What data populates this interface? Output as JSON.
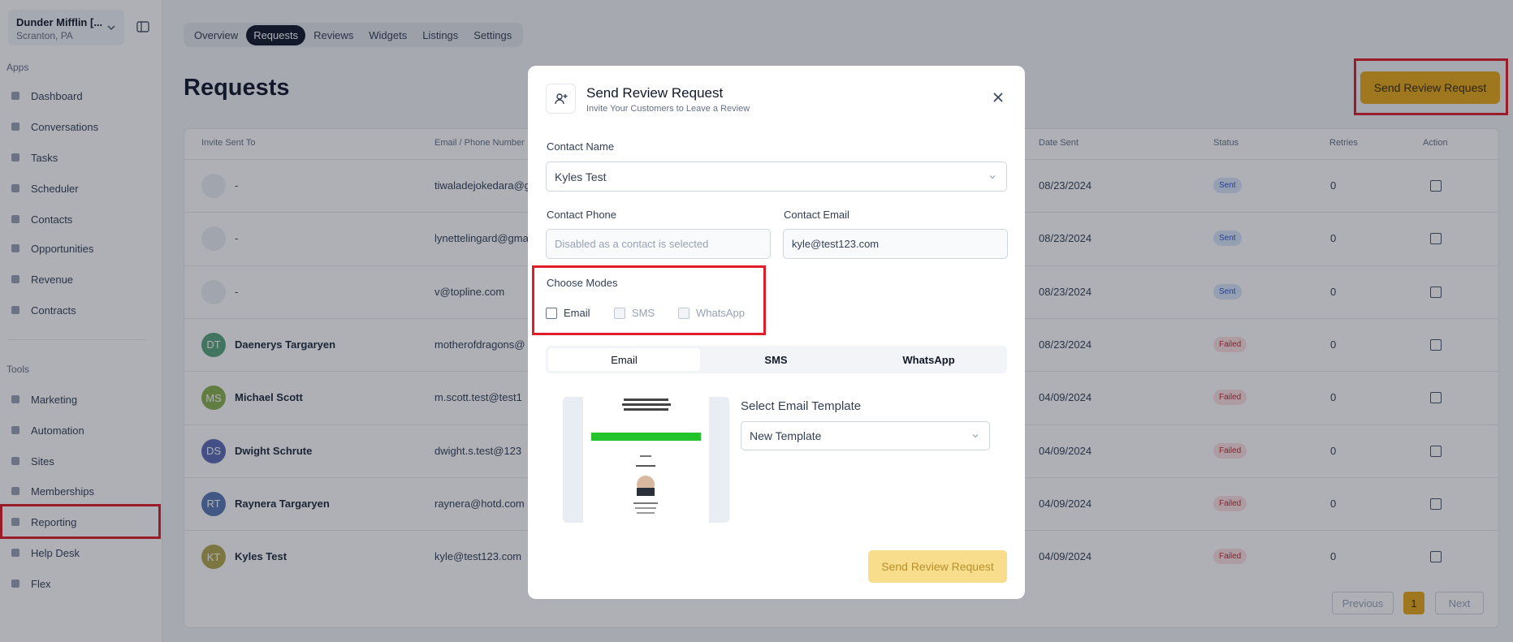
{
  "sidebar": {
    "location_name": "Dunder Mifflin [...",
    "location_sub": "Scranton, PA",
    "apps_label": "Apps",
    "tools_label": "Tools",
    "apps": [
      "Dashboard",
      "Conversations",
      "Tasks",
      "Scheduler",
      "Contacts",
      "Opportunities",
      "Revenue",
      "Contracts"
    ],
    "tools": [
      "Marketing",
      "Automation",
      "Sites",
      "Memberships",
      "Reporting",
      "Help Desk",
      "Flex"
    ]
  },
  "tabs": [
    "Overview",
    "Requests",
    "Reviews",
    "Widgets",
    "Listings",
    "Settings"
  ],
  "active_tab": "Requests",
  "page_title": "Requests",
  "primary_button": "Send Review Request",
  "table": {
    "headers": [
      "Invite Sent To",
      "Email / Phone Number",
      "Date Sent",
      "Status",
      "Retries",
      "Action"
    ],
    "rows": [
      {
        "initials": "",
        "name": "-",
        "contact": "tiwaladejokedara@g",
        "date": "08/23/2024",
        "status": "Sent",
        "retries": "0"
      },
      {
        "initials": "",
        "name": "-",
        "contact": "lynettelingard@gma",
        "date": "08/23/2024",
        "status": "Sent",
        "retries": "0"
      },
      {
        "initials": "",
        "name": "-",
        "contact": "v@topline.com",
        "date": "08/23/2024",
        "status": "Sent",
        "retries": "0"
      },
      {
        "initials": "DT",
        "name": "Daenerys Targaryen",
        "contact": "motherofdragons@",
        "date": "08/23/2024",
        "status": "Failed",
        "retries": "0"
      },
      {
        "initials": "MS",
        "name": "Michael Scott",
        "contact": "m.scott.test@test1",
        "date": "04/09/2024",
        "status": "Failed",
        "retries": "0"
      },
      {
        "initials": "DS",
        "name": "Dwight Schrute",
        "contact": "dwight.s.test@123",
        "date": "04/09/2024",
        "status": "Failed",
        "retries": "0"
      },
      {
        "initials": "RT",
        "name": "Raynera Targaryen",
        "contact": "raynera@hotd.com",
        "date": "04/09/2024",
        "status": "Failed",
        "retries": "0"
      },
      {
        "initials": "KT",
        "name": "Kyles Test",
        "contact": "kyle@test123.com",
        "date": "04/09/2024",
        "status": "Failed",
        "retries": "0"
      }
    ]
  },
  "pagination": {
    "previous": "Previous",
    "page": "1",
    "next": "Next"
  },
  "modal": {
    "title": "Send Review Request",
    "subtitle": "Invite Your Customers to Leave a Review",
    "contact_name_label": "Contact Name",
    "contact_name_value": "Kyles Test",
    "contact_phone_label": "Contact Phone",
    "contact_phone_placeholder": "Disabled as a contact is selected",
    "contact_email_label": "Contact Email",
    "contact_email_value": "kyle@test123.com",
    "modes_label": "Choose Modes",
    "modes": [
      "Email",
      "SMS",
      "WhatsApp"
    ],
    "channel_tabs": [
      "Email",
      "SMS",
      "WhatsApp"
    ],
    "template_label": "Select Email Template",
    "template_value": "New Template",
    "submit": "Send Review Request"
  },
  "colors": {
    "accent": "#e6a817",
    "highlight": "#e11d2a",
    "avatar_colors": [
      "#5aa57a",
      "#8ab14c",
      "#5d6bb4",
      "#5a79b2",
      "#b3a84e"
    ]
  }
}
